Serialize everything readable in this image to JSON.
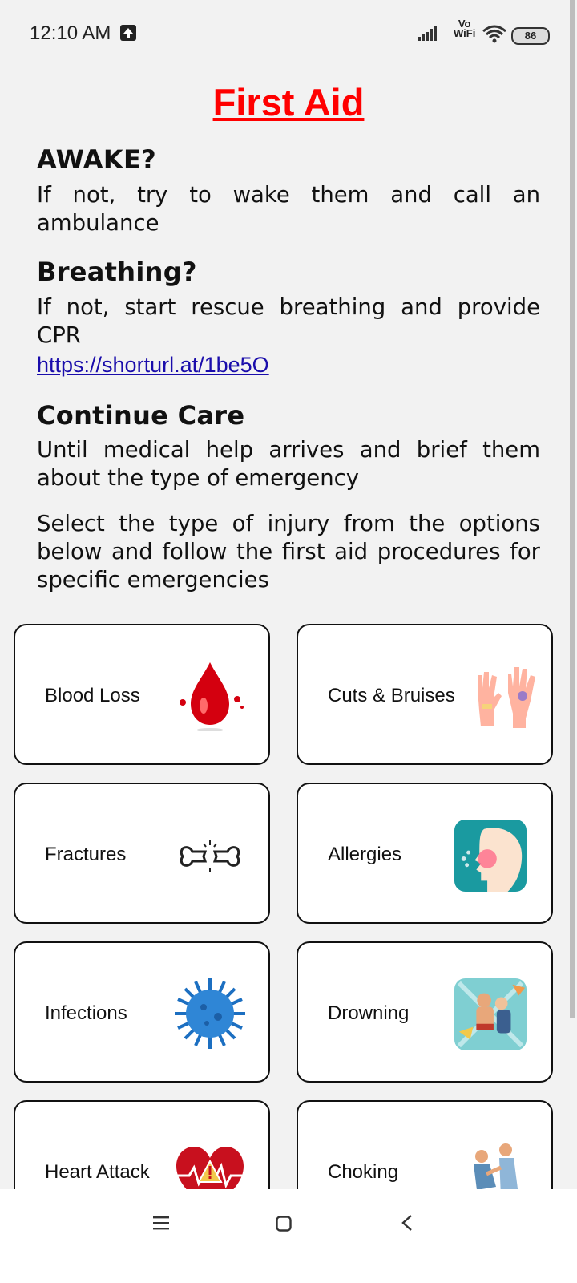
{
  "status_bar": {
    "time": "12:10 AM",
    "vowifi_top": "Vo",
    "vowifi_bottom": "WiFi",
    "battery": "86"
  },
  "page": {
    "title": "First Aid",
    "awake_heading": "AWAKE?",
    "awake_text": "If not, try to wake them and call an ambulance",
    "breathing_heading": "Breathing?",
    "breathing_text": "If not, start rescue breathing and provide CPR",
    "cpr_link": " https://shorturl.at/1be5O",
    "continue_heading": "Continue Care",
    "continue_text": "Until medical help arrives and brief them about the type of emergency",
    "select_text": "Select the type of injury from the options below and follow the first aid procedures for specific emergencies"
  },
  "injuries": [
    {
      "label": "Blood Loss",
      "icon": "blood-drop-icon"
    },
    {
      "label": "Cuts & Bruises",
      "icon": "bruised-hand-icon"
    },
    {
      "label": "Fractures",
      "icon": "broken-bone-icon"
    },
    {
      "label": "Allergies",
      "icon": "allergy-face-icon"
    },
    {
      "label": "Infections",
      "icon": "virus-icon"
    },
    {
      "label": "Drowning",
      "icon": "drowning-rescue-icon"
    },
    {
      "label": "Heart Attack",
      "icon": "heart-warning-icon"
    },
    {
      "label": "Choking",
      "icon": "choking-person-icon"
    }
  ],
  "colors": {
    "title": "#ff0000",
    "link": "#1a0dab",
    "background": "#f2f2f2"
  }
}
